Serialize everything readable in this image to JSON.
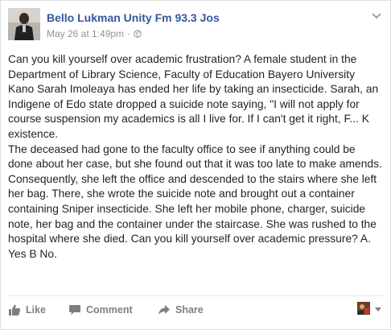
{
  "post": {
    "author": "Bello Lukman Unity Fm 93.3 Jos",
    "date": "May 26 at 1:49pm",
    "separator": "·",
    "paragraphs": [
      "Can you kill yourself over academic frustration? A female student in the Department of Library Science, Faculty of Education Bayero University Kano Sarah Imoleaya has ended her life by taking an insecticide. Sarah, an Indigene of Edo state dropped a suicide note saying, \"I will not apply for course suspension my academics is all I live for. If I can't get it right, F... K existence.",
      "The deceased had gone to the faculty office to see if anything could be done about her case, but she found out that it was too late to make amends.",
      "Consequently, she left the office and descended to the stairs where she left her bag. There, she wrote the suicide note and brought out a container containing Sniper insecticide. She left her mobile phone, charger, suicide note, her bag and the container under the staircase. She was rushed to the hospital where she died. Can you kill yourself over academic pressure? A. Yes B No."
    ]
  },
  "actions": {
    "like_label": "Like",
    "comment_label": "Comment",
    "share_label": "Share"
  },
  "icons": {
    "privacy": "globe-icon",
    "menu": "chevron-down-icon",
    "like": "thumbs-up-icon",
    "comment": "speech-bubble-icon",
    "share": "share-arrow-icon"
  },
  "colors": {
    "author_link": "#365899",
    "meta_text": "#90949c",
    "body_text": "#1d2129",
    "action_text": "#7f7f7f"
  }
}
